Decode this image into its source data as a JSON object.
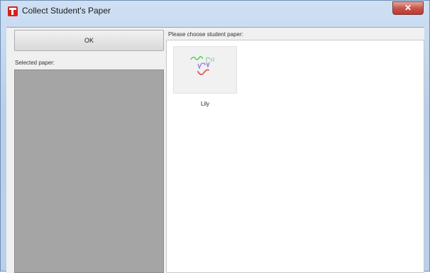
{
  "window": {
    "title": "Collect Student's Paper",
    "close_label": "✕"
  },
  "left_panel": {
    "ok_label": "OK",
    "selected_label": "Selected paper:"
  },
  "right_panel": {
    "choose_label": "Please choose student paper:",
    "papers": [
      {
        "name": "Lily"
      }
    ]
  },
  "colors": {
    "accent_red": "#d4231d",
    "selected_area": "#a5a5a5",
    "thumb_bg": "#f1f1f1"
  }
}
